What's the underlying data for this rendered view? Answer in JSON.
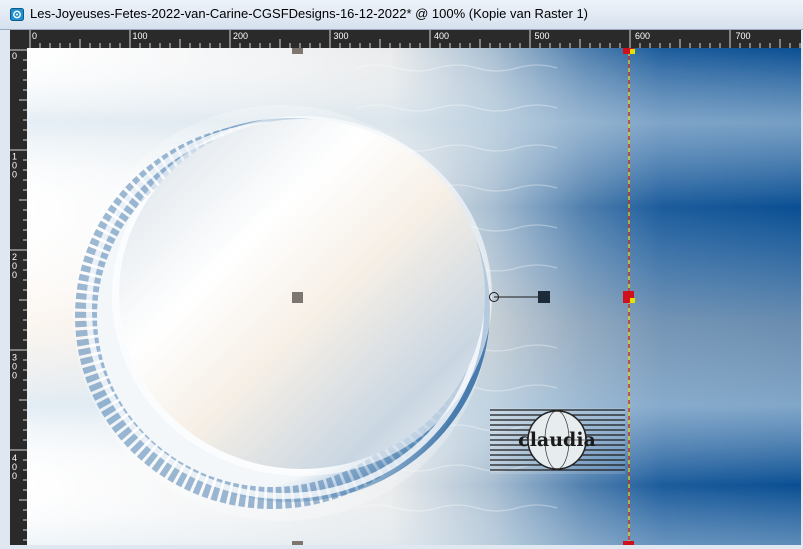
{
  "window": {
    "title": "Les-Joyeuses-Fetes-2022-van-Carine-CGSFDesigns-16-12-2022* @ 100% (Kopie van Raster 1)",
    "icon": "psp-app-icon"
  },
  "ruler": {
    "h_labels": [
      "0",
      "100",
      "200",
      "300",
      "400",
      "500",
      "600",
      "700"
    ],
    "v_labels": [
      [
        "0"
      ],
      [
        "1",
        "0",
        "0"
      ],
      [
        "2",
        "0",
        "0"
      ],
      [
        "3",
        "0",
        "0"
      ],
      [
        "4",
        "0",
        "0"
      ]
    ]
  },
  "watermark": {
    "text": "claudia"
  },
  "colors": {
    "canvas_dark_blue": "#0a4f93",
    "guide_yellow": "#e8e000",
    "guide_red": "#d0101c"
  }
}
